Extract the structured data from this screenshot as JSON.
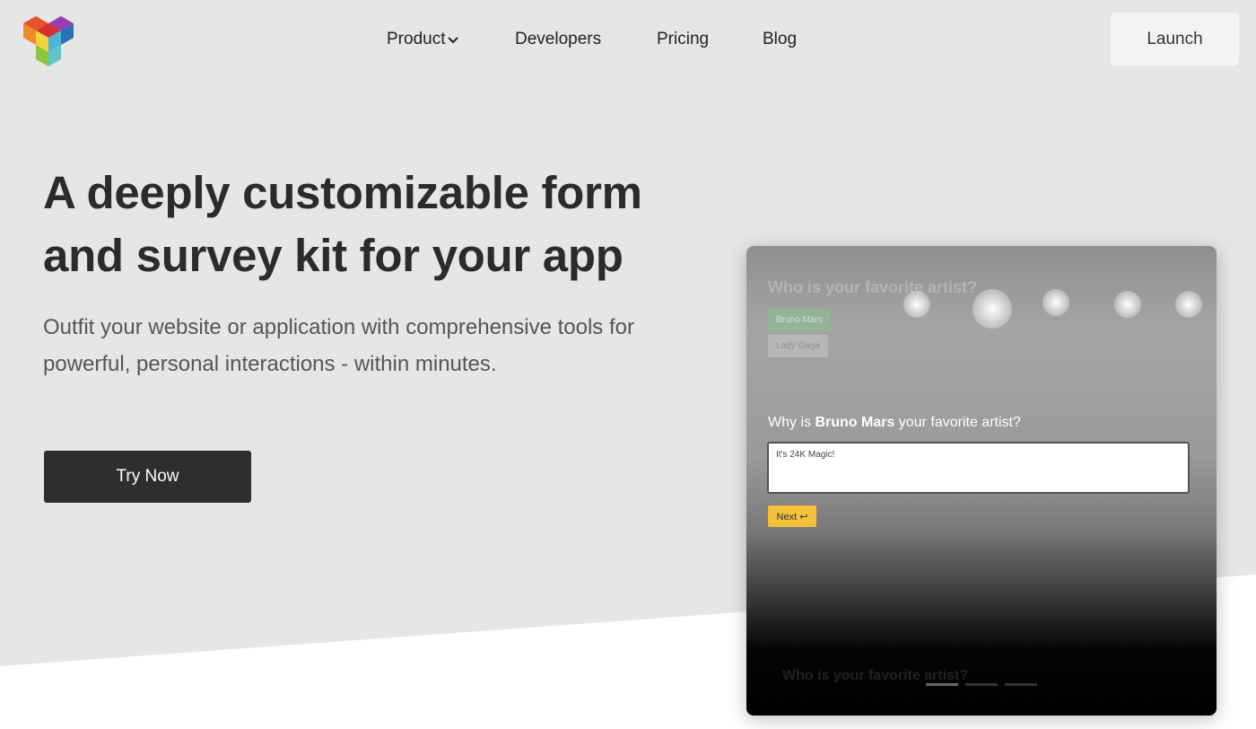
{
  "nav": {
    "items": [
      {
        "label": "Product",
        "has_dropdown": true
      },
      {
        "label": "Developers"
      },
      {
        "label": "Pricing"
      },
      {
        "label": "Blog"
      }
    ],
    "launch_label": "Launch"
  },
  "hero": {
    "title": "A deeply customizable form and survey kit for your app",
    "subtitle": "Outfit your website or application with comprehensive tools for powerful, personal interactions - within minutes.",
    "cta_label": "Try Now"
  },
  "demo": {
    "prev_question": "Who is your favorite artist?",
    "options": [
      "Bruno Mars",
      "Lady Gaga"
    ],
    "question_prefix": "Why is ",
    "question_bold": "Bruno Mars",
    "question_suffix": " your favorite artist?",
    "answer": "It's 24K Magic!",
    "next_label": "Next",
    "next_question": "Who is your favorite artist?",
    "accent_color": "#f5c03a",
    "progress_steps": 3,
    "progress_current": 1
  }
}
